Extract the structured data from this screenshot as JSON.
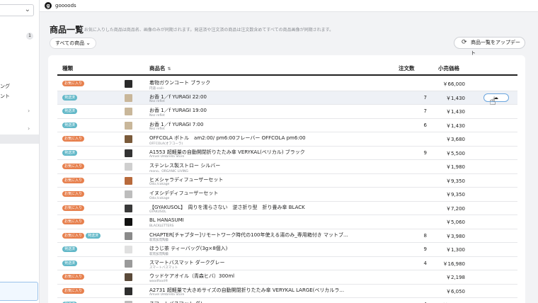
{
  "app": {
    "brand": "goooods"
  },
  "sidebar": {
    "badge_count": "1",
    "text_a": "ング",
    "text_b": "ント"
  },
  "header": {
    "title": "商品一覧",
    "note": "※ お気に入りした商品は商品名、画像のみが同期されます。発送済や注文済の商品は注文数含めてすべての商品画像が同期されます。",
    "filter_label": "すべての商品",
    "update_label": "商品一覧をアップデート"
  },
  "table": {
    "columns": {
      "type": "種類",
      "name": "商品名",
      "qty": "注文数",
      "price": "小売価格"
    },
    "badge_labels": {
      "fav": "お気に入り",
      "ship": "発送済"
    },
    "rows": [
      {
        "badges": [
          "fav"
        ],
        "thumb": "#2a2a2a",
        "name": "着物ガウンコート ブラック",
        "shop": "円道-coili-",
        "qty": "",
        "price": "￥66,000"
      },
      {
        "badges": [
          "ship"
        ],
        "thumb": "#c9b79a",
        "name": "お香 1／f YURAGI 22:00",
        "shop": "Nez reflet",
        "qty": "7",
        "price": "￥1,430",
        "highlight": true
      },
      {
        "badges": [
          "ship"
        ],
        "thumb": "#c9b79a",
        "name": "お香 1／f YURAGI 19:00",
        "shop": "Nez reflet",
        "qty": "7",
        "price": "￥1,430"
      },
      {
        "badges": [
          "ship"
        ],
        "thumb": "#c9b79a",
        "name": "お香 1／f YURAGI 7:00",
        "shop": "Nez reflet",
        "qty": "6",
        "price": "￥1,430"
      },
      {
        "badges": [
          "fav"
        ],
        "thumb": "#7a5a3a",
        "name": "OFFCOLA ボトル　am2:00/ pm6:00フレーバー OFFCOLA pm6:00",
        "shop": "OFFCOLA(オフコーラ)",
        "qty": "",
        "price": "￥3,680"
      },
      {
        "badges": [
          "ship"
        ],
        "thumb": "#333333",
        "name": "A1553 超軽量の自動開閉折りたたみ傘 VERYKAL(ベリカル) ブラック",
        "shop": "Amvel Umbrella Store",
        "qty": "9",
        "price": "￥5,500"
      },
      {
        "badges": [
          "fav"
        ],
        "thumb": "#cfcfcf",
        "name": "ステンレス製ストロー シルバー",
        "shop": "mono、ORGANIC LIVING",
        "qty": "",
        "price": "￥1,980"
      },
      {
        "badges": [
          "fav"
        ],
        "thumb": "#b86a3c",
        "name": "ヒメシャラディフューザーセット",
        "shop": "Odo:/cokage",
        "qty": "",
        "price": "￥9,350"
      },
      {
        "badges": [
          "fav"
        ],
        "thumb": "#bdbdbd",
        "name": "イヌシデディフューザーセット",
        "shop": "Odo:/cokage",
        "qty": "",
        "price": "￥9,350"
      },
      {
        "badges": [
          "fav"
        ],
        "thumb": "#3a3a3a",
        "name": "【GYAKUSOL】　周りを濡らさない　逆さ折り型　折り畳み傘 BLACK",
        "shop": "GYAKUSOL",
        "qty": "",
        "price": "￥7,200"
      },
      {
        "badges": [
          "fav"
        ],
        "thumb": "#111111",
        "name": "BL HANASUMI",
        "shop": "BLACKLETTERS",
        "qty": "",
        "price": "￥5,060"
      },
      {
        "badges": [
          "fav",
          "ship"
        ],
        "thumb": "#8a8a8a",
        "name": "CHAPTER[チャプター]リモートワーク時代の100年使える湯のみ_専用箱付き マットブ...",
        "shop": "萩窯加茂陶藝",
        "qty": "8",
        "price": "￥3,980"
      },
      {
        "badges": [
          "ship"
        ],
        "thumb": "#e0e0e0",
        "name": "ほうじ茶 ティーバッグ(3g×8個入)",
        "shop": "萩窯加茂陶藝",
        "qty": "9",
        "price": "￥1,300"
      },
      {
        "badges": [
          "ship"
        ],
        "thumb": "#9a9a9a",
        "name": "スマートバスマット ダークグレー",
        "shop": "スマートバスマット",
        "qty": "4",
        "price": "￥16,980"
      },
      {
        "badges": [
          "fav"
        ],
        "thumb": "#5a4a3a",
        "name": "ウッドケアオイル（青森ヒバ）300ml",
        "shop": "woodfood®",
        "qty": "",
        "price": "￥2,198"
      },
      {
        "badges": [
          "fav"
        ],
        "thumb": "#2e2e2e",
        "name": "A2731 超軽量で大きめサイズの自動開閉折りたたみ傘 VERYKAL LARGE(ベリカルラ...",
        "shop": "Amvel Umbrella Store",
        "qty": "",
        "price": "￥6,050"
      },
      {
        "badges": [
          "ship"
        ],
        "thumb": "#bcbcbc",
        "name": "スマートバスマット グレー",
        "shop": "スマートバスマット",
        "qty": "4",
        "price": "￥16,980"
      }
    ]
  },
  "icons": {
    "logo": "brand-logo-icon",
    "chevron": "chevron-down-icon",
    "refresh": "refresh-icon",
    "cloud": "cloud-upload-icon",
    "cursor": "hand-pointer-icon"
  }
}
